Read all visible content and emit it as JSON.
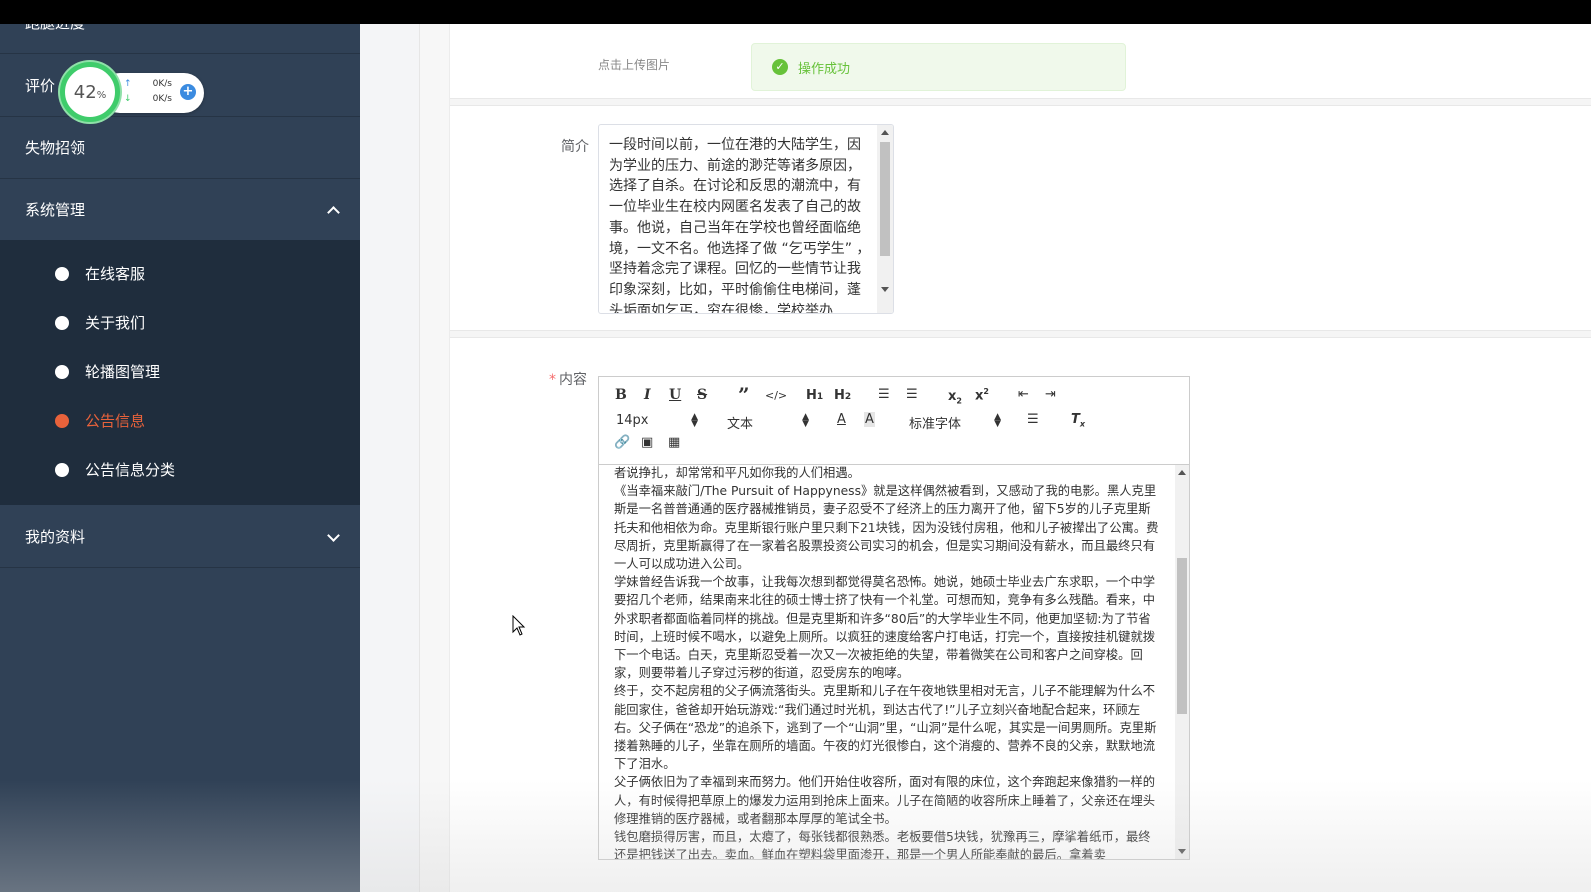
{
  "sidebar": {
    "items": [
      {
        "label": "跑腿进度"
      },
      {
        "label": "评价"
      },
      {
        "label": "失物招领"
      },
      {
        "label": "系统管理"
      },
      {
        "label": "我的资料"
      }
    ],
    "submenu": [
      {
        "label": "在线客服"
      },
      {
        "label": "关于我们"
      },
      {
        "label": "轮播图管理"
      },
      {
        "label": "公告信息"
      },
      {
        "label": "公告信息分类"
      }
    ],
    "active_submenu": "公告信息",
    "active_color": "#e8623b"
  },
  "speed_widget": {
    "percent": "42",
    "percent_sign": "%",
    "upload": "0K/s",
    "download": "0K/s"
  },
  "form": {
    "upload_hint": "点击上传图片",
    "toast": "操作成功",
    "intro_label": "简介",
    "intro_text": "一段时间以前，一位在港的大陆学生，因为学业的压力、前途的渺茫等诸多原因，选择了自杀。在讨论和反思的潮流中，有一位毕业生在校内网匿名发表了自己的故事。他说，自己当年在学校也曾经面临绝境，一文不名。他选择了做 “乞丐学生” ，坚持着念完了课程。回忆的一些情节让我印象深刻，比如，平时偷偷住电梯间，蓬头垢面如乞丐，穷在很惨，学校举办",
    "content_required": "*",
    "content_label": "内容"
  },
  "editor": {
    "font_size": "14px",
    "block_type": "文本",
    "font_family": "标准字体",
    "paragraphs": [
      "者说挣扎，却常常和平凡如你我的人们相遇。",
      "《当幸福来敲门/The Pursuit of Happyness》就是这样偶然被看到，又感动了我的电影。黑人克里斯是一名普普通通的医疗器械推销员，妻子忍受不了经济上的压力离开了他，留下5岁的儿子克里斯托夫和他相依为命。克里斯银行账户里只剩下21块钱，因为没钱付房租，他和儿子被撵出了公寓。费尽周折，克里斯赢得了在一家着名股票投资公司实习的机会，但是实习期间没有薪水，而且最终只有一人可以成功进入公司。",
      "学妹曾经告诉我一个故事，让我每次想到都觉得莫名恐怖。她说，她硕士毕业去广东求职，一个中学要招几个老师，结果南来北往的硕士博士挤了快有一个礼堂。可想而知，竞争有多么残酷。看来，中外求职者都面临着同样的挑战。但是克里斯和许多“80后”的大学毕业生不同，他更加坚韧:为了节省时间，上班时候不喝水，以避免上厕所。以疯狂的速度给客户打电话，打完一个，直接按挂机键就拨下一个电话。白天，克里斯忍受着一次又一次被拒绝的失望，带着微笑在公司和客户之间穿梭。回家，则要带着儿子穿过污秽的街道，忍受房东的咆哮。",
      "终于，交不起房租的父子俩流落街头。克里斯和儿子在午夜地铁里相对无言，儿子不能理解为什么不能回家住，爸爸却开始玩游戏:“我们通过时光机，到达古代了!”儿子立刻兴奋地配合起来，环顾左右。父子俩在“恐龙”的追杀下，逃到了一个“山洞”里，“山洞”是什么呢，其实是一间男厕所。克里斯搂着熟睡的儿子，坐靠在厕所的墙面。午夜的灯光很惨白，这个消瘦的、营养不良的父亲，默默地流下了泪水。",
      "父子俩依旧为了幸福到来而努力。他们开始住收容所，面对有限的床位，这个奔跑起来像猎豹一样的人，有时候得把草原上的爆发力运用到抢床上面来。儿子在简陋的收容所床上睡着了，父亲还在埋头修理推销的医疗器械，或者翻那本厚厚的笔试全书。",
      "钱包磨损得厉害，而且，太瘪了，每张钱都很熟悉。老板要借5块钱，犹豫再三，摩挲着纸币，最终还是把钱送了出去。卖血。鲜血在塑料袋里面渗开，那是一个男人所能奉献的最后。拿着卖"
    ]
  }
}
